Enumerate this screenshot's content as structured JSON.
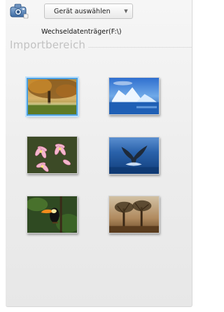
{
  "toolbar": {
    "device_icon": "camera-device-icon",
    "device_select": {
      "label": "Gerät auswählen",
      "arrow_icon": "chevron-down-icon"
    }
  },
  "device": {
    "path": "Wechseldatenträger(F:\\)"
  },
  "import_area": {
    "title": "Importbereich",
    "thumbnails": [
      {
        "subject": "autumn-tree-landscape",
        "selected": true
      },
      {
        "subject": "icebergs-blue-water",
        "selected": false
      },
      {
        "subject": "pink-frangipani-flowers",
        "selected": false
      },
      {
        "subject": "whale-tail-ocean",
        "selected": false
      },
      {
        "subject": "toucan-bird-jungle",
        "selected": false
      },
      {
        "subject": "savanna-trees-sunset",
        "selected": false
      }
    ]
  },
  "colors": {
    "selection_border": "#4da0e0",
    "section_title": "#c2c2c2"
  }
}
